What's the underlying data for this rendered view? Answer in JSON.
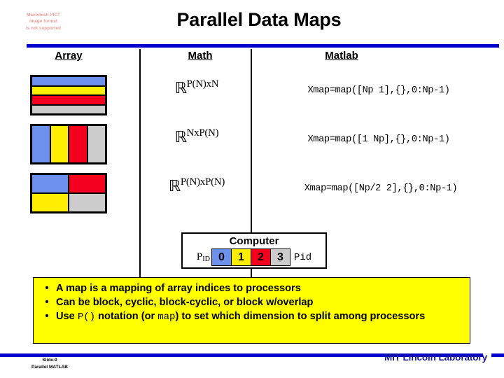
{
  "slide": {
    "title": "Parallel Data Maps",
    "broken_image_notice": [
      "Macintosh PICT",
      "image format",
      "is not supported"
    ],
    "rule_color": "#0000cc"
  },
  "columns": {
    "array": "Array",
    "math": "Math",
    "matlab": "Matlab"
  },
  "rows": [
    {
      "math_base": "ℝ",
      "math_exponent": "P(N)xN",
      "matlab": "Xmap=map([Np 1],{},0:Np-1)",
      "figure": "rows-split",
      "cells": [
        "blue",
        "yellow",
        "red",
        "gray"
      ]
    },
    {
      "math_base": "ℝ",
      "math_exponent": "NxP(N)",
      "matlab": "Xmap=map([1 Np],{},0:Np-1)",
      "figure": "columns-split",
      "cells": [
        "blue",
        "yellow",
        "red",
        "gray"
      ]
    },
    {
      "math_base": "ℝ",
      "math_exponent": "P(N)xP(N)",
      "matlab": "Xmap=map([Np/2 2],{},0:Np-1)",
      "figure": "block-split",
      "cells": [
        "blue",
        "red",
        "yellow",
        "gray"
      ]
    }
  ],
  "legend": {
    "title": "Computer",
    "pid_label": "P",
    "pid_subscript": "ID",
    "pid_code": "Pid",
    "cells": [
      {
        "label": "0",
        "color": "#6c91ed"
      },
      {
        "label": "1",
        "color": "#ffee00"
      },
      {
        "label": "2",
        "color": "#f4001e"
      },
      {
        "label": "3",
        "color": "#cccccc"
      }
    ]
  },
  "bullets": [
    {
      "marker": "•",
      "part1": "A map is a mapping of array indices to processors",
      "mono1": "",
      "part2": "",
      "mono2": "",
      "part3": ""
    },
    {
      "marker": "•",
      "part1": "Can be block, cyclic, block-cyclic, or block w/overlap",
      "mono1": "",
      "part2": "",
      "mono2": "",
      "part3": ""
    },
    {
      "marker": "•",
      "part1": "Use ",
      "mono1": "P()",
      "part2": " notation (or ",
      "mono2": "map",
      "part3": ") to set which dimension to split among processors"
    }
  ],
  "footer": {
    "slide_number": "Slide-9",
    "deck_name": "Parallel MATLAB",
    "organization": "MIT Lincoln Laboratory",
    "organization_color": "#1a1a99"
  },
  "palette": {
    "blue": "#6c91ed",
    "yellow": "#ffee00",
    "red": "#f4001e",
    "gray": "#cccccc"
  }
}
